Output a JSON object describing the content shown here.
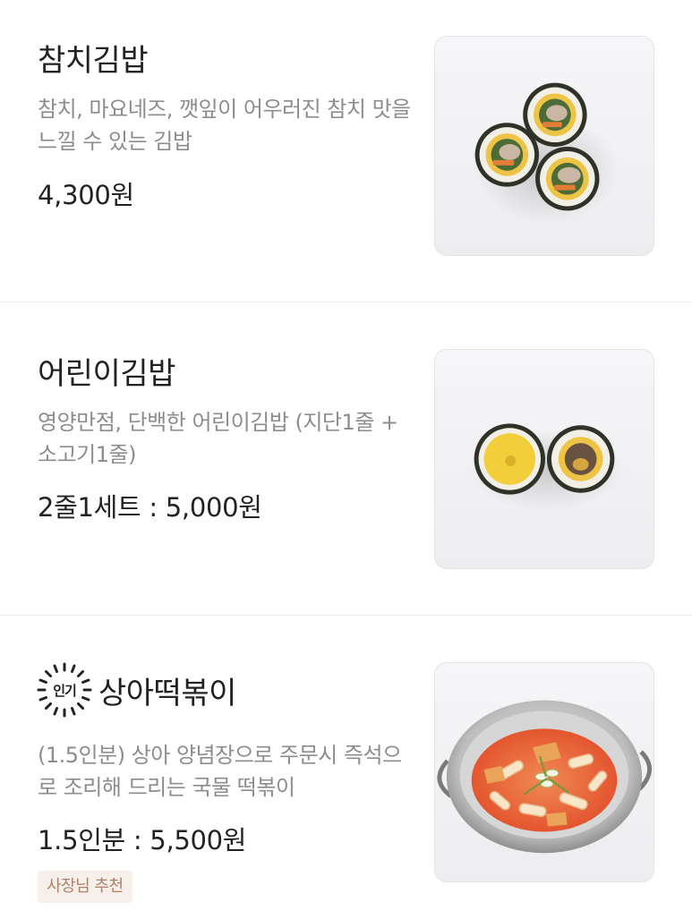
{
  "menu": {
    "items": [
      {
        "name": "참치김밥",
        "description": "참치, 마요네즈, 깻잎이 어우러진 참치 맛을 느낄 수 있는 김밥",
        "price": "4,300원",
        "image_icon": "tuna-kimbap-photo"
      },
      {
        "name": "어린이김밥",
        "description": "영양만점, 단백한 어린이김밥 (지단1줄 + 소고기1줄)",
        "price": "2줄1세트 : 5,000원",
        "image_icon": "kids-kimbap-photo"
      },
      {
        "name": "상아떡볶이",
        "badge": "인기",
        "description": "(1.5인분) 상아 양념장으로 주문시 즉석으로 조리해 드리는 국물 떡볶이",
        "price": "1.5인분 : 5,500원",
        "tag": "사장님 추천",
        "image_icon": "tteokbokki-photo"
      }
    ]
  },
  "colors": {
    "text": "#222222",
    "description": "#8d8d8d",
    "divider": "#ececec",
    "tag_background": "#f7efe9",
    "tag_text": "#b0806a"
  }
}
